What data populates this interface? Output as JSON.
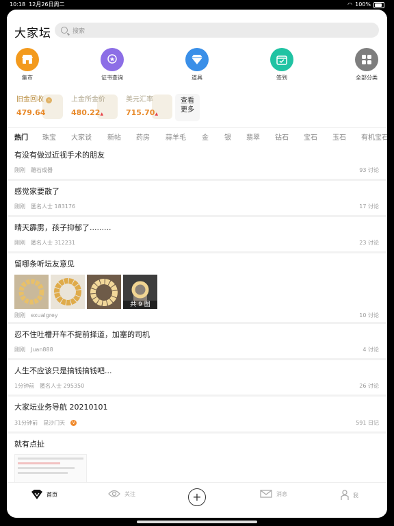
{
  "status": {
    "time": "10:18",
    "date": "12月26日周二",
    "battery": "100%"
  },
  "header": {
    "logo": "大家坛",
    "search_placeholder": "搜索"
  },
  "quick": [
    {
      "label": "集市",
      "icon": "shop-icon",
      "color": "#f39a1d"
    },
    {
      "label": "证书查询",
      "icon": "certificate-icon",
      "color": "#8c6ee6"
    },
    {
      "label": "道具",
      "icon": "diamond-icon",
      "color": "#3a8fe8"
    },
    {
      "label": "签到",
      "icon": "calendar-icon",
      "color": "#20c3a3"
    },
    {
      "label": "全部分类",
      "icon": "grid-icon",
      "color": "#7e7e7e"
    }
  ],
  "prices": [
    {
      "title": "旧金回收",
      "value": "479.64"
    },
    {
      "title": "上金所金价",
      "value": "480.22"
    },
    {
      "title": "美元汇率",
      "value": "715.70"
    }
  ],
  "more_label_1": "查看",
  "more_label_2": "更多",
  "tabs": [
    "热门",
    "珠宝",
    "大家谈",
    "新帖",
    "药房",
    "蒜羊毛",
    "金",
    "银",
    "翡翠",
    "钻石",
    "宝石",
    "玉石",
    "有机宝石"
  ],
  "posts": [
    {
      "title": "有没有做过近视手术的朋友",
      "time": "刚刚",
      "author": "雕石成器",
      "count": "93 讨论"
    },
    {
      "title": "感觉家要散了",
      "time": "刚刚",
      "author": "匿名人士 183176",
      "count": "17 讨论"
    },
    {
      "title": "晴天霹雳，孩子抑郁了.........",
      "time": "刚刚",
      "author": "匿名人士 312231",
      "count": "23 讨论"
    },
    {
      "title": "留哪条听坛友意见",
      "time": "刚刚",
      "author": "exualgrey",
      "count": "10 讨论",
      "more_photos": "共 9 图"
    },
    {
      "title": "忍不住吐槽开车不提前择道，加塞的司机",
      "time": "刚刚",
      "author": "Juan888",
      "count": "4 讨论"
    },
    {
      "title": "人生不应该只是搞钱搞钱吧...",
      "time": "1分钟前",
      "author": "匿名人士 295350",
      "count": "26 讨论"
    },
    {
      "title": "大家坛业务导航 20210101",
      "time": "31分钟前",
      "author": "昆沙门天",
      "count": "591 日记",
      "badge": "V"
    },
    {
      "title": "就有点扯"
    }
  ],
  "tabbar": {
    "home": "首页",
    "follow": "关注",
    "messages": "消息",
    "me": "我"
  }
}
